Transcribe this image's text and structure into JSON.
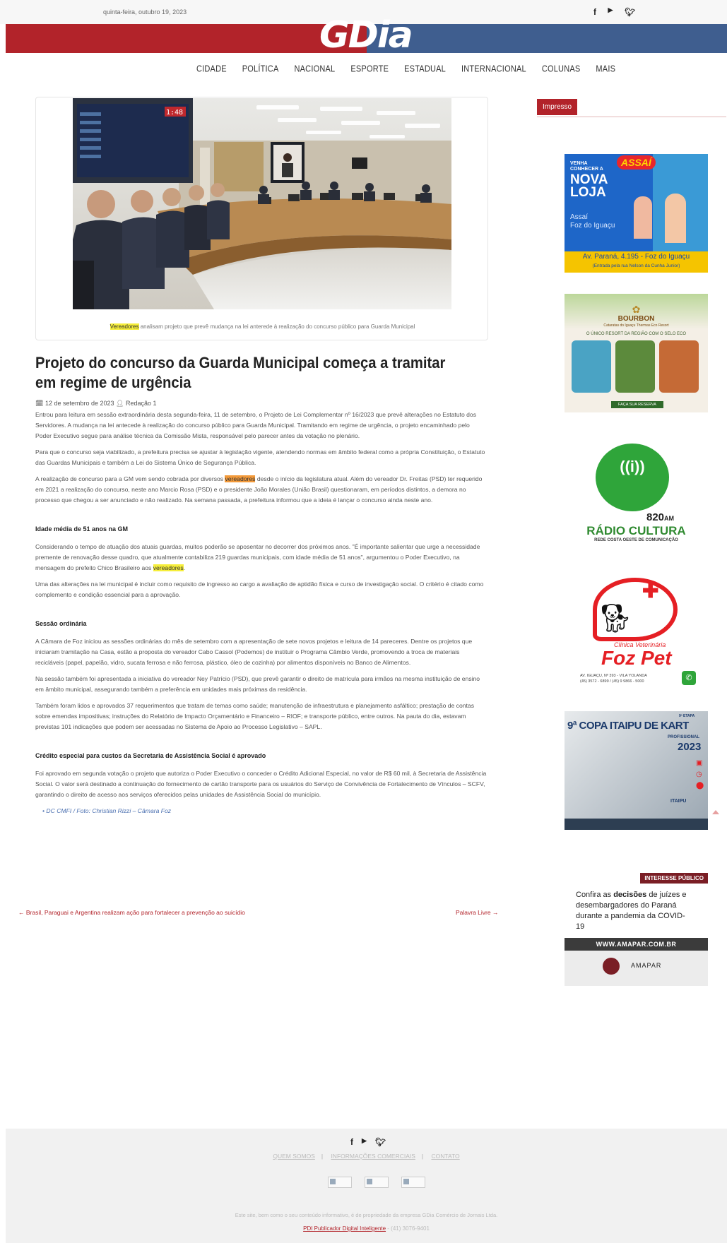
{
  "topbar": {
    "date": "quinta-feira, outubro 19, 2023",
    "social": [
      "f",
      "You Tube",
      "twitter"
    ]
  },
  "logo": {
    "text": "GDia"
  },
  "nav": [
    "CIDADE",
    "POLÍTICA",
    "NACIONAL",
    "ESPORTE",
    "ESTADUAL",
    "INTERNACIONAL",
    "COLUNAS",
    "MAIS"
  ],
  "figure": {
    "caption_highlight": "Vereadores",
    "caption_rest": " analisam projeto que prevê mudança na lei anterede à realização do concurso público para Guarda Municipal",
    "screen_text": "1:48"
  },
  "article": {
    "title": "Projeto do concurso da Guarda Municipal começa a tramitar em regime de urgência",
    "date": "12 de setembro de 2023",
    "author": "Redação 1",
    "p1": "Entrou para leitura em sessão extraordinária desta segunda-feira, 11 de setembro, o Projeto de Lei Complementar nº 16/2023 que prevê alterações no Estatuto dos Servidores. A mudança na lei antecede à realização do concurso público para Guarda Municipal. Tramitando em regime de urgência, o projeto encaminhado pelo Poder Executivo segue para análise técnica da Comissão Mista, responsável pelo parecer antes da votação no plenário.",
    "p2": "Para que o concurso seja viabilizado, a prefeitura precisa se ajustar à legislação vigente, atendendo normas em âmbito federal como a própria Constituição, o Estatuto das Guardas Municipais e também a Lei do Sistema Único de Segurança Pública.",
    "p3_a": "A realização de concurso para a GM vem sendo cobrada por diversos ",
    "p3_hl": "vereadores",
    "p3_b": " desde o início da legislatura atual. Além do vereador Dr. Freitas (PSD) ter requerido em 2021 a realização do concurso, neste ano Marcio Rosa (PSD) e o presidente João Morales (União Brasil) questionaram, em períodos distintos, a demora no processo que chegou a ser anunciado e não realizado. Na semana passada, a prefeitura informou que a ideia é lançar o concurso ainda neste ano.",
    "h1": "Idade média de 51 anos na GM",
    "p4_a": "Considerando o tempo de atuação dos atuais guardas, muitos poderão se aposentar no decorrer dos próximos anos. \"É importante salientar que urge a necessidade premente de renovação desse quadro, que atualmente contabiliza 219 guardas municipais, com idade média de 51 anos\", argumentou o Poder Executivo, na mensagem do prefeito Chico Brasileiro aos ",
    "p4_hl": "vereadores",
    "p4_b": ".",
    "p5": "Uma das alterações na lei municipal é incluir como requisito de ingresso ao cargo a avaliação de aptidão física e curso de investigação social. O critério é citado como complemento e condição essencial para a aprovação.",
    "h2": "Sessão ordinária",
    "p6": "A Câmara de Foz iniciou as sessões ordinárias do mês de setembro com a apresentação de sete novos projetos e leitura de 14 pareceres. Dentre os projetos que iniciaram tramitação na Casa, estão a proposta do vereador Cabo Cassol (Podemos) de instituir o Programa Câmbio Verde, promovendo a troca de materiais recicláveis (papel, papelão, vidro, sucata ferrosa e não ferrosa, plástico, óleo de cozinha) por alimentos disponíveis no Banco de Alimentos.",
    "p7": "Na sessão também foi apresentada a iniciativa do vereador Ney Patrício (PSD), que prevê garantir o direito de matrícula para irmãos na mesma instituição de ensino em âmbito municipal, assegurando também a preferência em unidades mais próximas da residência.",
    "p8": "Também foram lidos e aprovados 37 requerimentos que tratam de temas como saúde; manutenção de infraestrutura e planejamento asfáltico; prestação de contas sobre emendas impositivas; instruções do Relatório de Impacto Orçamentário e Financeiro – RIOF; e transporte público, entre outros. Na pauta do dia, estavam previstas 101 indicações que podem ser acessadas no Sistema de Apoio ao Processo Legislativo – SAPL.",
    "h3": "Crédito especial para custos da Secretaria de Assistência Social é aprovado",
    "p9": "Foi aprovado em segunda votação o projeto que autoriza o Poder Executivo o conceder o Crédito Adicional Especial, no valor de R$ 60 mil, à Secretaria de Assistência Social. O valor será destinado a continuação do fornecimento de cartão transporte para os usuários do Serviço de Convivência de Fortalecimento de Vínculos – SCFV, garantindo o direito de acesso aos serviços oferecidos pelas unidades de Assistência Social do município.",
    "credit": "DC CMFI / Foto: Christian Rizzi – Câmara Foz",
    "prev": "← Brasil, Paraguai e Argentina realizam ação para fortalecer a prevenção ao suicídio",
    "next": "Palavra Livre →"
  },
  "sidebar": {
    "impresso": "Impresso",
    "assai": {
      "line1": "VENHA CONHECER A",
      "line2": "NOVA LOJA",
      "city1": "Assaí",
      "city2": "Foz do Iguaçu",
      "brand": "ASSAÍ",
      "addr": "Av. Paraná, 4.195 - Foz do Iguaçu",
      "addr2": "(Entrada pela rua Nelson da Cunha Junior)"
    },
    "bourbon": {
      "name": "BOURBON",
      "sub": "Cataratas do Iguaçu Thermas Eco Resort",
      "tag": "O ÚNICO RESORT DA REGIÃO COM O SELO ECO",
      "cta": "FAÇA SUA RESERVA"
    },
    "radio": {
      "freq": "820",
      "am": "AM",
      "name": "RÁDIO CULTURA",
      "net": "REDE COSTA OESTE DE COMUNICAÇÃO"
    },
    "pet": {
      "clinic": "Clínica Veterinária",
      "name": "Foz Pet",
      "addr": "AV. IGUAÇU, Nº 393 - VILA YOLANDA",
      "phone": "(45) 3572 - 6899 / (45) 9 9866 - 5000"
    },
    "kart": {
      "etapa": "9ª ETAPA",
      "title": "9ª COPA ITAIPU DE KART",
      "sub": "PROFISSIONAL",
      "year": "2023",
      "brand": "ITAIPU"
    },
    "amapar": {
      "tag": "INTERESSE PÚBLICO",
      "text_a": "Confira as ",
      "text_b": "decisões",
      "text_c": " de juízes e desembargadores do Paraná durante a pandemia da COVID-19",
      "url": "WWW.AMAPAR.COM.BR",
      "brand": "AMAPAR"
    }
  },
  "footer": {
    "social": [
      "f",
      "You Tube",
      "twitter"
    ],
    "links": [
      "QUEM SOMOS",
      "INFORMAÇÕES COMERCIAIS",
      "CONTATO"
    ],
    "copyright": "Este site, bem como o seu conteúdo informativo, é de propriedade da empresa GDia Comércio de Jornais Ltda.",
    "pdi": "PDI Publicador Digital Inteligente",
    "phone": "- (41) 3076-9401"
  },
  "colors": {
    "red": "#b2232a",
    "blue": "#3f5e8f",
    "highlight": "#f6ee3b"
  }
}
